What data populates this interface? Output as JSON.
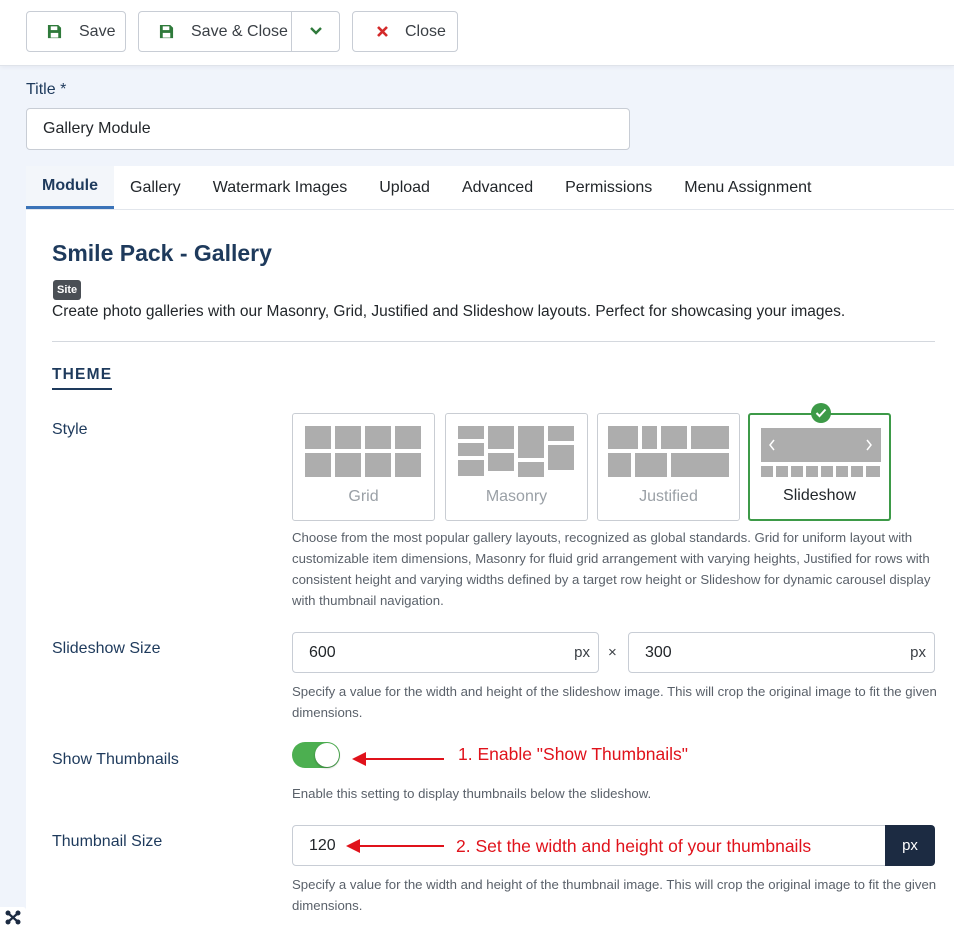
{
  "toolbar": {
    "save_label": "Save",
    "save_close_label": "Save & Close",
    "close_label": "Close"
  },
  "form": {
    "title_label": "Title *",
    "title_value": "Gallery Module"
  },
  "tabs": [
    {
      "label": "Module",
      "active": true
    },
    {
      "label": "Gallery"
    },
    {
      "label": "Watermark Images"
    },
    {
      "label": "Upload"
    },
    {
      "label": "Advanced"
    },
    {
      "label": "Permissions"
    },
    {
      "label": "Menu Assignment"
    }
  ],
  "module": {
    "title": "Smile Pack - Gallery",
    "badge": "Site",
    "description": "Create photo galleries with our Masonry, Grid, Justified and Slideshow layouts. Perfect for showcasing your images."
  },
  "theme": {
    "section_title": "THEME",
    "style_label": "Style",
    "styles": [
      "Grid",
      "Masonry",
      "Justified",
      "Slideshow"
    ],
    "selected_style": "Slideshow",
    "style_help": "Choose from the most popular gallery layouts, recognized as global standards. Grid for uniform layout with customizable item dimensions, Masonry for fluid grid arrangement with varying heights, Justified for rows with consistent height and varying widths defined by a target row height or Slideshow for dynamic carousel display with thumbnail navigation.",
    "slideshow_size_label": "Slideshow Size",
    "slideshow_width": "600",
    "slideshow_height": "300",
    "unit": "px",
    "times": "×",
    "slideshow_help": "Specify a value for the width and height of the slideshow image. This will crop the original image to fit the given dimensions.",
    "show_thumbnails_label": "Show Thumbnails",
    "show_thumbnails_on": true,
    "show_thumbnails_help": "Enable this setting to display thumbnails below the slideshow.",
    "thumbnail_size_label": "Thumbnail Size",
    "thumbnail_size": "120",
    "thumbnail_help": "Specify a value for the width and height of the thumbnail image. This will crop the original image to fit the given dimensions."
  },
  "annotations": {
    "step1": "1. Enable \"Show Thumbnails\"",
    "step2": "2. Set the width and height of your thumbnails"
  },
  "colors": {
    "accent": "#3a73b8",
    "success": "#3d9a48",
    "annotation": "#e0121b",
    "dark_navy": "#1c2b42"
  }
}
